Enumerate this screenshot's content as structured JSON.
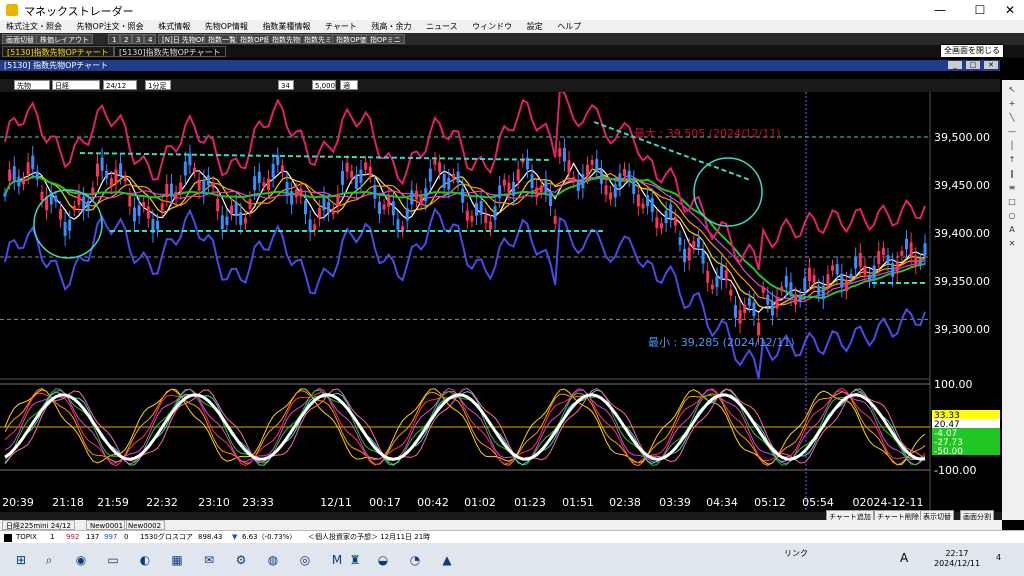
{
  "app": {
    "title": "マネックストレーダー"
  },
  "window_controls": {
    "min": "—",
    "max": "☐",
    "close": "✕"
  },
  "menu": [
    "株式注文・照会",
    "先物OP注文・照会",
    "株式情報",
    "先物OP情報",
    "指数業種情報",
    "チャート",
    "残高・余力",
    "ニュース",
    "ウィンドウ",
    "設定",
    "ヘルプ"
  ],
  "toolbar": {
    "items": [
      "画面切替",
      "株価レイアウト",
      "1",
      "2",
      "3",
      "4",
      "[N]日 先物OP",
      "指数一覧",
      "指数OP総合",
      "指数先物",
      "指数先ミニ",
      "指数OP価格",
      "指OPミニ"
    ],
    "tooltip": "全画面を閉じる"
  },
  "tabs": [
    "[5130]指数先物OPチャート",
    "[5130]指数先物OPチャート"
  ],
  "subwindow": {
    "title": "[5130] 指数先物OPチャート",
    "btn_min": "_",
    "btn_max": "□",
    "btn_close": "✕"
  },
  "controls": {
    "type": "先物",
    "underlying": "日経225mini",
    "month": "24/12",
    "mode": "1分足",
    "period": "34",
    "count": "5,000",
    "apply": "適用"
  },
  "chart": {
    "price_labels": [
      "39,500.00",
      "39,450.00",
      "39,400.00",
      "39,350.00",
      "39,300.00"
    ],
    "max_label": "最大 : 39,505 (2024/12/11)",
    "min_label": "最小 : 39,285 (2024/12/11)",
    "osc_labels": {
      "top": "100.00",
      "bottom": "-100.00",
      "v1": "33.33",
      "v2": "20.47",
      "v3": "-4.07",
      "v4": "-27.73",
      "v5": "-50.00"
    },
    "time_labels": [
      "20:39",
      "21:18",
      "21:59",
      "22:32",
      "23:10",
      "23:33",
      "12/11",
      "00:17",
      "00:42",
      "01:02",
      "01:23",
      "01:51",
      "02:38",
      "03:39",
      "04:34",
      "05:12",
      "05:54",
      "02024-12-11"
    ]
  },
  "bottom_buttons": [
    "チャート追加",
    "チャート削除",
    "表示切替",
    "画面分割"
  ],
  "chart_tabs": [
    "日経225mini 24/12",
    "New0001",
    "New0002"
  ],
  "ticker": {
    "name": "TOPIX",
    "f1": "1",
    "f2": "992",
    "f3": "137",
    "f4": "997",
    "f5": "0",
    "instrument": "1530グロスコア",
    "price": "898.43",
    "change": "6.63（-0.73%）",
    "news": "＜個人投資家の予想＞ 12月11日 21時"
  },
  "taskbar": {
    "status": "リンク",
    "ime": "A",
    "time": "22:17",
    "date": "2024/12/11",
    "notif": "4"
  },
  "colors": {
    "upper_band": "#e0206a",
    "lower_band": "#4a4ae8",
    "ma_green": "#22c622",
    "ma_yellow": "#e8e800",
    "highlight_cyan": "#3ed6c0",
    "osc_white": "#ffffff",
    "accent_red": "#c8102e"
  }
}
